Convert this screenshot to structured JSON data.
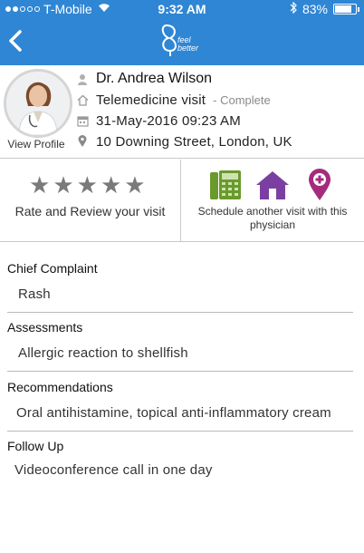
{
  "status_bar": {
    "carrier": "T-Mobile",
    "time": "9:32 AM",
    "battery": "83%",
    "battery_level": 0.83,
    "signal_bars": 2
  },
  "nav": {
    "logo_top": "feel",
    "logo_bottom": "better"
  },
  "doctor": {
    "name": "Dr. Andrea Wilson",
    "visit_type": "Telemedicine visit",
    "visit_status": "- Complete",
    "datetime": "31-May-2016 09:23 AM",
    "address": "10 Downing Street, London, UK",
    "view_profile": "View Profile"
  },
  "rating": {
    "stars": 5,
    "filled": 0,
    "label": "Rate and Review your visit"
  },
  "schedule": {
    "label": "Schedule another visit with this physician",
    "icons": [
      "phone-icon",
      "home-icon",
      "map-pin-icon"
    ]
  },
  "sections": [
    {
      "title": "Chief Complaint",
      "value": "Rash"
    },
    {
      "title": "Assessments",
      "value": "Allergic reaction to shellfish"
    },
    {
      "title": "Recommendations",
      "value": "Oral antihistamine, topical anti-inflammatory cream"
    },
    {
      "title": "Follow Up",
      "value": "Videoconference call in one day"
    }
  ],
  "colors": {
    "brand_blue": "#2f86d4",
    "phone_green": "#6a9a2c",
    "home_purple": "#7b3fa1",
    "pin_magenta": "#a52c7c"
  }
}
